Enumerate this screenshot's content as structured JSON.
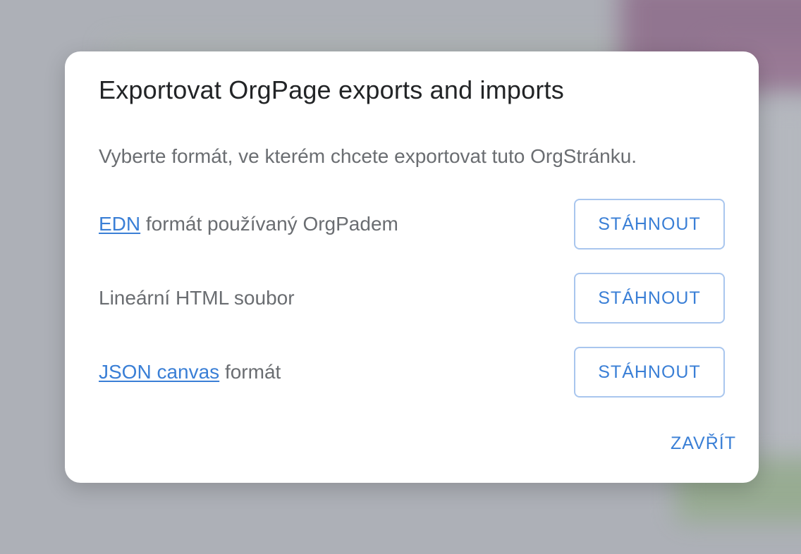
{
  "dialog": {
    "title": "Exportovat OrgPage exports and imports",
    "description": "Vyberte formát, ve kterém chcete exportovat tuto OrgStránku.",
    "formats": [
      {
        "link": "EDN",
        "text": " formát používaný OrgPadem",
        "button": "STÁHNOUT"
      },
      {
        "link": "",
        "text": "Lineární HTML soubor",
        "button": "STÁHNOUT"
      },
      {
        "link": "JSON canvas",
        "text": " formát",
        "button": "STÁHNOUT"
      }
    ],
    "close_label": "ZAVŘÍT"
  },
  "colors": {
    "accent": "#3a7fd6",
    "button_border": "#a9c6ee",
    "text_muted": "#6a6d71",
    "title": "#222426",
    "overlay": "#adb0b7"
  }
}
